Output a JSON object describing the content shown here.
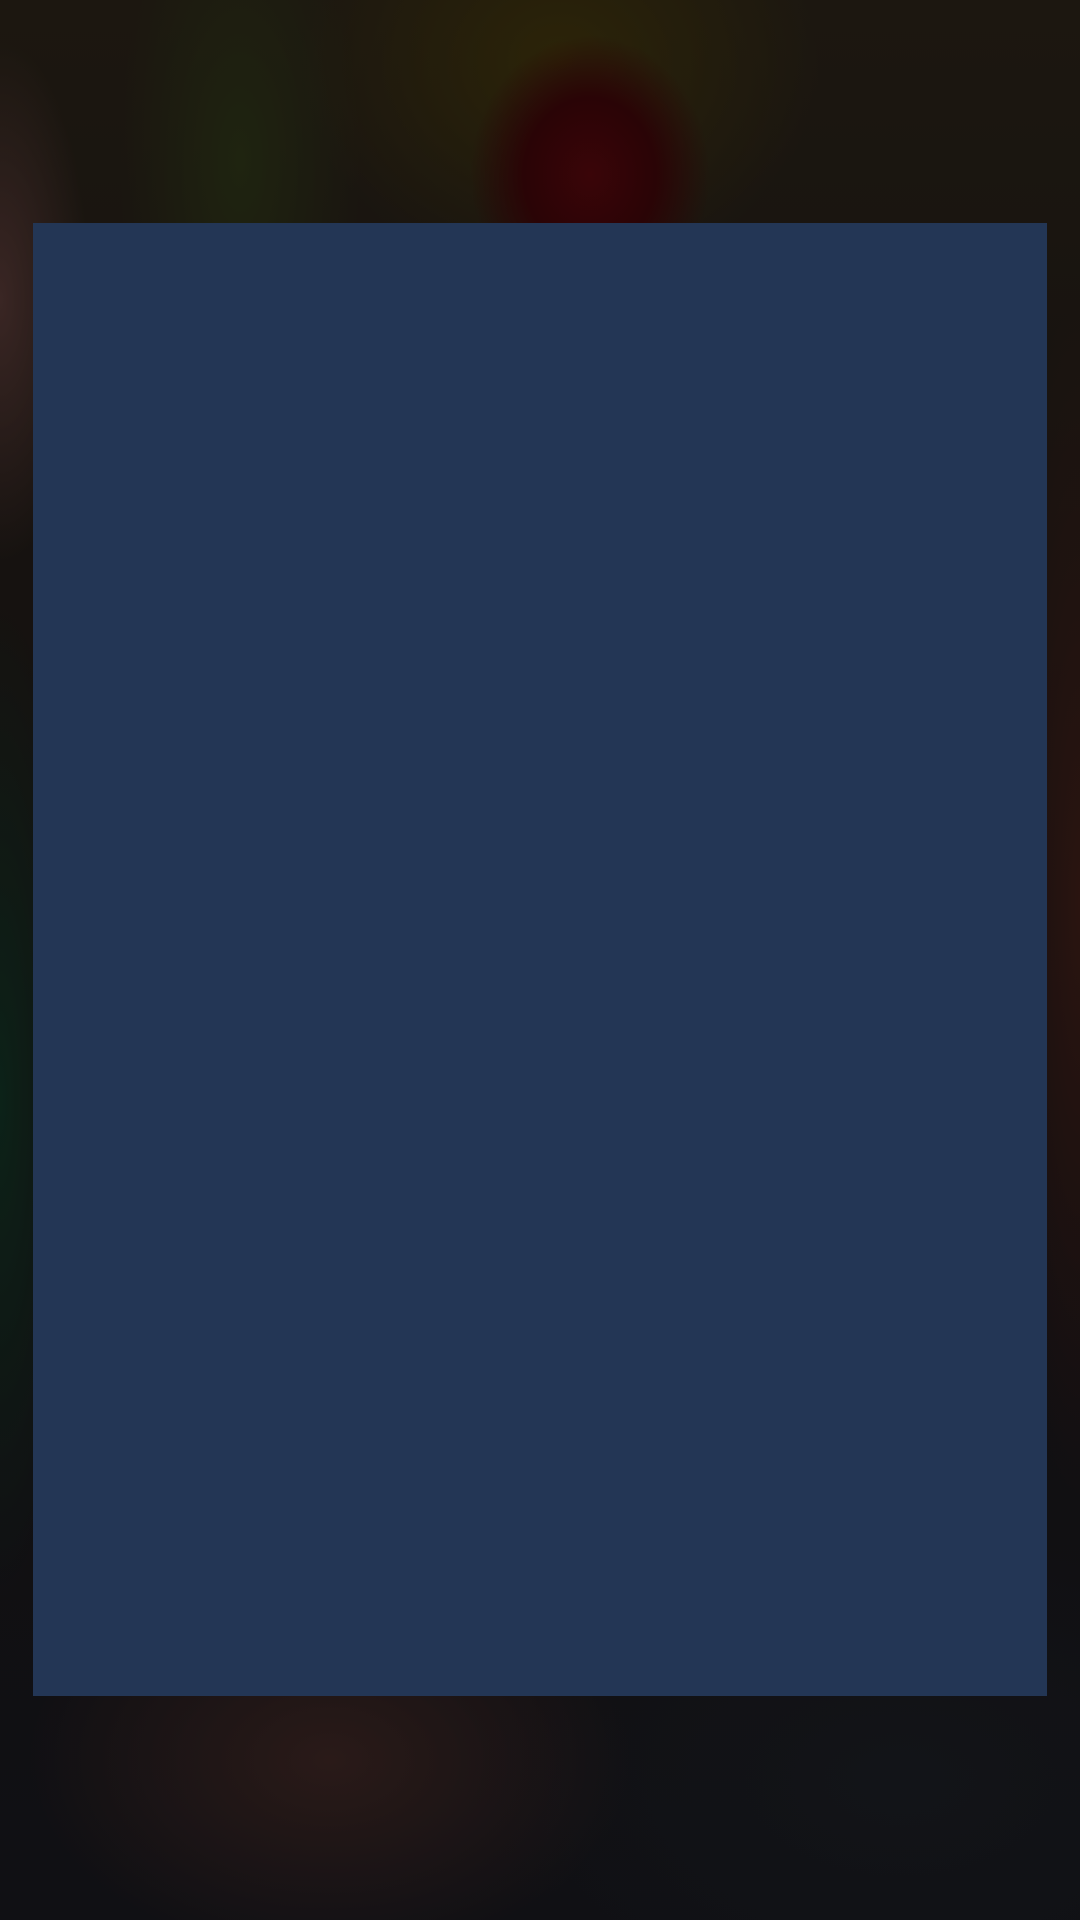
{
  "colors": {
    "modal_background": "#233655",
    "backdrop_tint": "#120f10"
  },
  "backdrop": {
    "description_icon": "blurred-photo"
  },
  "modal": {}
}
